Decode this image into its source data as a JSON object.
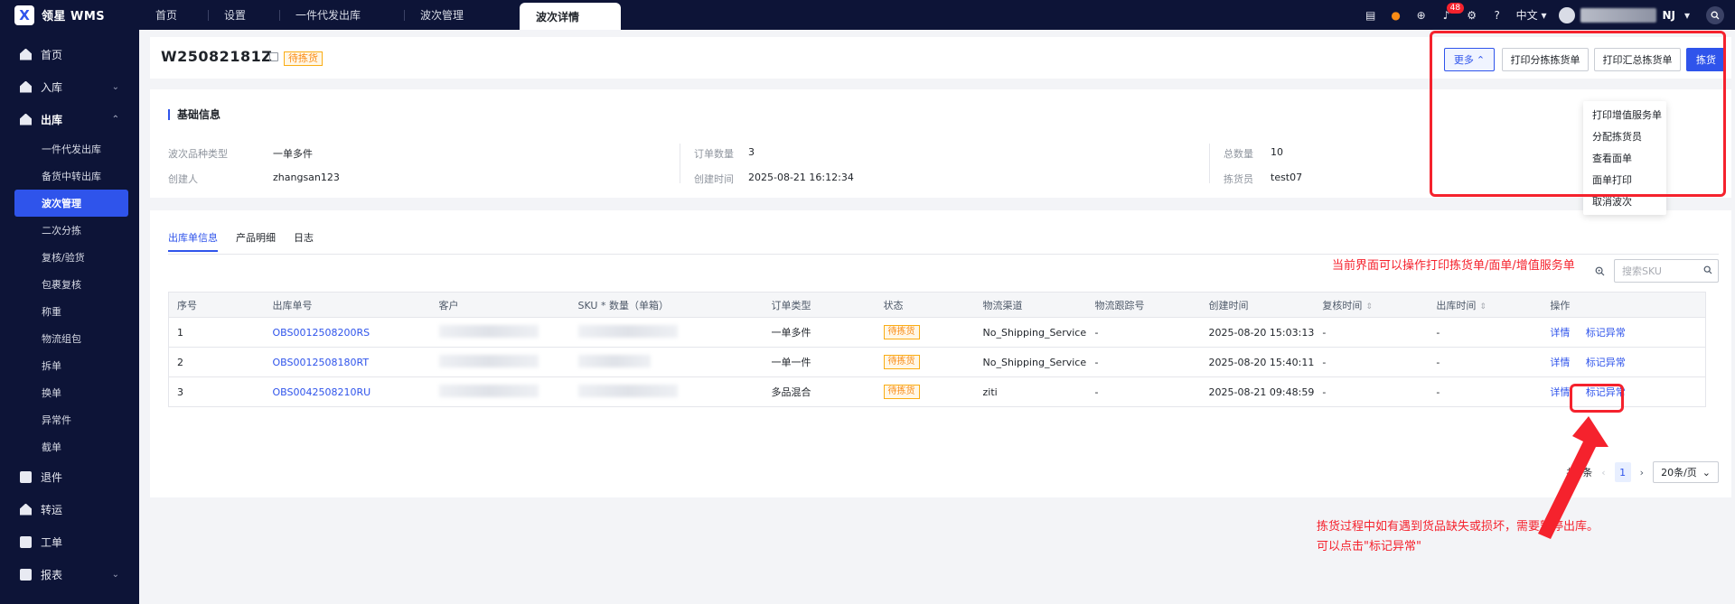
{
  "app": {
    "logo_text": "领星 WMS",
    "logo_mark": "X"
  },
  "tabs": [
    {
      "label": "首页"
    },
    {
      "label": "设置"
    },
    {
      "label": "一件代发出库"
    },
    {
      "label": "波次管理"
    },
    {
      "label": "波次详情",
      "active": true
    }
  ],
  "topbar": {
    "notification_count": "48",
    "language": "中文",
    "user_initials": "NJ"
  },
  "sidebar": {
    "items": [
      {
        "label": "首页"
      },
      {
        "label": "入库"
      },
      {
        "label": "出库"
      },
      {
        "label": "退件"
      },
      {
        "label": "转运"
      },
      {
        "label": "工单"
      },
      {
        "label": "报表"
      }
    ],
    "outbound_sub": [
      {
        "label": "一件代发出库"
      },
      {
        "label": "备货中转出库"
      },
      {
        "label": "波次管理",
        "active": true
      },
      {
        "label": "二次分拣"
      },
      {
        "label": "复核/验货"
      },
      {
        "label": "包裹复核"
      },
      {
        "label": "称重"
      },
      {
        "label": "物流组包"
      },
      {
        "label": "拆单"
      },
      {
        "label": "换单"
      },
      {
        "label": "异常件"
      },
      {
        "label": "截单"
      }
    ]
  },
  "header": {
    "order_id": "W25082181Z",
    "status": "待拣货",
    "buttons": {
      "more": "更多",
      "print_sorting": "打印分拣拣货单",
      "print_summary": "打印汇总拣货单",
      "pick": "拣货"
    }
  },
  "more_menu": [
    {
      "label": "打印增值服务单"
    },
    {
      "label": "分配拣货员"
    },
    {
      "label": "查看面单"
    },
    {
      "label": "面单打印"
    },
    {
      "label": "取消波次"
    }
  ],
  "basic_info": {
    "title": "基础信息",
    "fields": {
      "wave_type_label": "波次品种类型",
      "wave_type_value": "一单多件",
      "creator_label": "创建人",
      "creator_value": "zhangsan123",
      "order_count_label": "订单数量",
      "order_count_value": "3",
      "created_time_label": "创建时间",
      "created_time_value": "2025-08-21 16:12:34",
      "total_qty_label": "总数量",
      "total_qty_value": "10",
      "picker_label": "拣货员",
      "picker_value": "test07"
    }
  },
  "list": {
    "tabs": [
      {
        "label": "出库单信息",
        "active": true
      },
      {
        "label": "产品明细"
      },
      {
        "label": "日志"
      }
    ],
    "annotation_top": "当前界面可以操作打印拣货单/面单/增值服务单",
    "search_placeholder": "搜索SKU",
    "columns": [
      "序号",
      "出库单号",
      "客户",
      "SKU * 数量（单箱）",
      "订单类型",
      "状态",
      "物流渠道",
      "物流跟踪号",
      "创建时间",
      "复核时间",
      "出库时间",
      "操作"
    ],
    "rows": [
      {
        "no": "1",
        "order": "OBS0012508200RS",
        "type": "一单多件",
        "status": "待拣货",
        "channel": "No_Shipping_Service",
        "tracking": "-",
        "created": "2025-08-20 15:03:13",
        "reviewed": "-",
        "out": "-",
        "op_detail": "详情",
        "op_mark": "标记异常"
      },
      {
        "no": "2",
        "order": "OBS0012508180RT",
        "type": "一单一件",
        "status": "待拣货",
        "channel": "No_Shipping_Service",
        "tracking": "-",
        "created": "2025-08-20 15:40:11",
        "reviewed": "-",
        "out": "-",
        "op_detail": "详情",
        "op_mark": "标记异常"
      },
      {
        "no": "3",
        "order": "OBS0042508210RU",
        "type": "多品混合",
        "status": "待拣货",
        "channel": "ziti",
        "tracking": "-",
        "created": "2025-08-21 09:48:59",
        "reviewed": "-",
        "out": "-",
        "op_detail": "详情",
        "op_mark": "标记异常"
      }
    ],
    "pager": {
      "total": "共3条",
      "page": "1",
      "page_size": "20条/页"
    }
  },
  "annotation_bottom": {
    "line1": "拣货过程中如有遇到货品缺失或损坏，需要暂停出库。",
    "line2": "可以点击\"标记异常\""
  },
  "colors": {
    "accent": "#2f54eb",
    "nav_bg": "#0d1437",
    "warning": "#fa8c16",
    "annotation": "#f5222d"
  }
}
